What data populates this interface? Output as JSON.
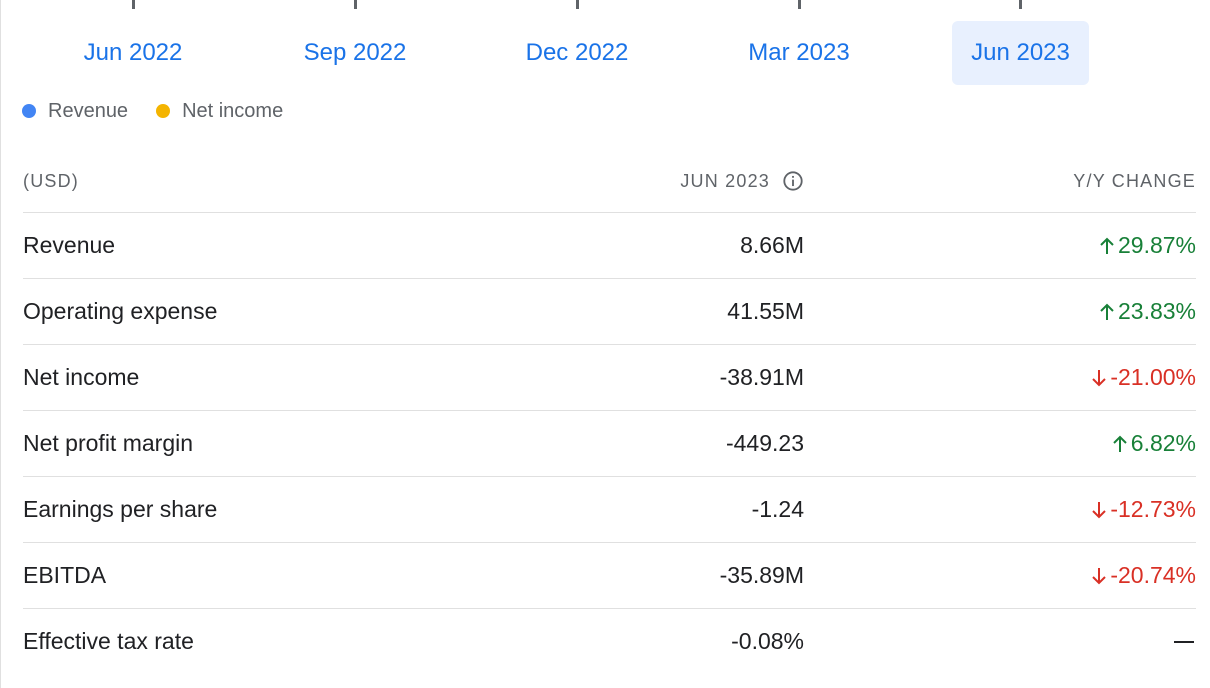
{
  "periods": [
    {
      "label": "Jun 2022",
      "selected": false
    },
    {
      "label": "Sep 2022",
      "selected": false
    },
    {
      "label": "Dec 2022",
      "selected": false
    },
    {
      "label": "Mar 2023",
      "selected": false
    },
    {
      "label": "Jun 2023",
      "selected": true
    }
  ],
  "legend": [
    {
      "label": "Revenue",
      "color": "#4285f4"
    },
    {
      "label": "Net income",
      "color": "#f4b400"
    }
  ],
  "table": {
    "header": {
      "currency": "(USD)",
      "period": "JUN 2023",
      "change": "Y/Y CHANGE"
    },
    "rows": [
      {
        "label": "Revenue",
        "value": "8.66M",
        "change": "29.87%",
        "direction": "up"
      },
      {
        "label": "Operating expense",
        "value": "41.55M",
        "change": "23.83%",
        "direction": "up"
      },
      {
        "label": "Net income",
        "value": "-38.91M",
        "change": "-21.00%",
        "direction": "down"
      },
      {
        "label": "Net profit margin",
        "value": "-449.23",
        "change": "6.82%",
        "direction": "up"
      },
      {
        "label": "Earnings per share",
        "value": "-1.24",
        "change": "-12.73%",
        "direction": "down"
      },
      {
        "label": "EBITDA",
        "value": "-35.89M",
        "change": "-20.74%",
        "direction": "down"
      },
      {
        "label": "Effective tax rate",
        "value": "-0.08%",
        "change": "",
        "direction": "none"
      }
    ]
  },
  "colors": {
    "accent": "#1a73e8",
    "selected_bg": "#e8f0fe",
    "positive": "#188038",
    "negative": "#d93025"
  },
  "icons": {
    "info": "info-icon",
    "up": "arrow-up-icon",
    "down": "arrow-down-icon",
    "none": "dash-icon"
  }
}
